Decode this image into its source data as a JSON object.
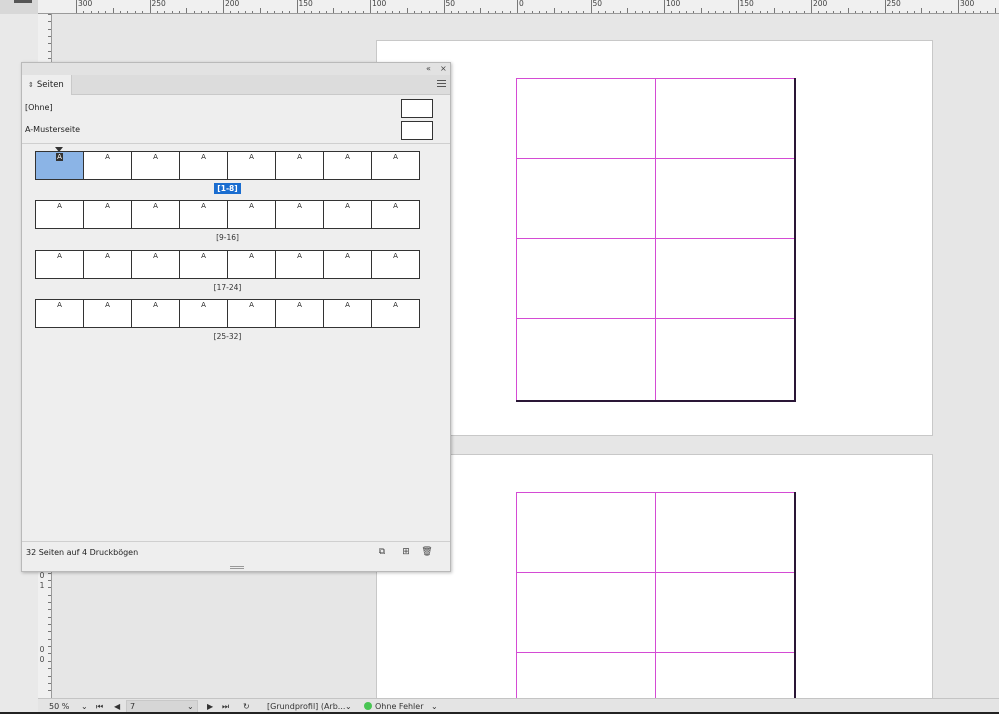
{
  "ruler_h_labels": [
    "300",
    "250",
    "200",
    "150",
    "100",
    "50",
    "0",
    "50",
    "100",
    "150",
    "200",
    "250",
    "300"
  ],
  "ruler_v_labels": [
    "0",
    "1",
    "0",
    "0"
  ],
  "panel": {
    "collapse_icon": "double-chevron-left-icon",
    "close_icon": "close-icon",
    "tab_label": "Seiten",
    "menu_icon": "hamburger-menu-icon",
    "masters": [
      {
        "label": "[Ohne]"
      },
      {
        "label": "A-Musterseite"
      }
    ],
    "spreads": [
      {
        "caption": "[1-8]",
        "pages": [
          "A",
          "A",
          "A",
          "A",
          "A",
          "A",
          "A",
          "A"
        ],
        "selected": true
      },
      {
        "caption": "[9-16]",
        "pages": [
          "A",
          "A",
          "A",
          "A",
          "A",
          "A",
          "A",
          "A"
        ],
        "selected": false
      },
      {
        "caption": "[17-24]",
        "pages": [
          "A",
          "A",
          "A",
          "A",
          "A",
          "A",
          "A",
          "A"
        ],
        "selected": false
      },
      {
        "caption": "[25-32]",
        "pages": [
          "A",
          "A",
          "A",
          "A",
          "A",
          "A",
          "A",
          "A"
        ],
        "selected": false
      }
    ],
    "status": "32 Seiten auf 4 Druckbögen",
    "footer_icons": [
      "page-size-icon",
      "new-page-icon",
      "trash-icon"
    ]
  },
  "statusbar": {
    "zoom": "50 %",
    "page_input": "7",
    "profile": "[Grundprofil] (Arb...",
    "preflight": "Ohne Fehler",
    "preflight_color": "#49c553"
  },
  "colors": {
    "guide": "#d44bd4",
    "selection": "#1a6dd0",
    "selected_page": "#8bb4e6"
  }
}
